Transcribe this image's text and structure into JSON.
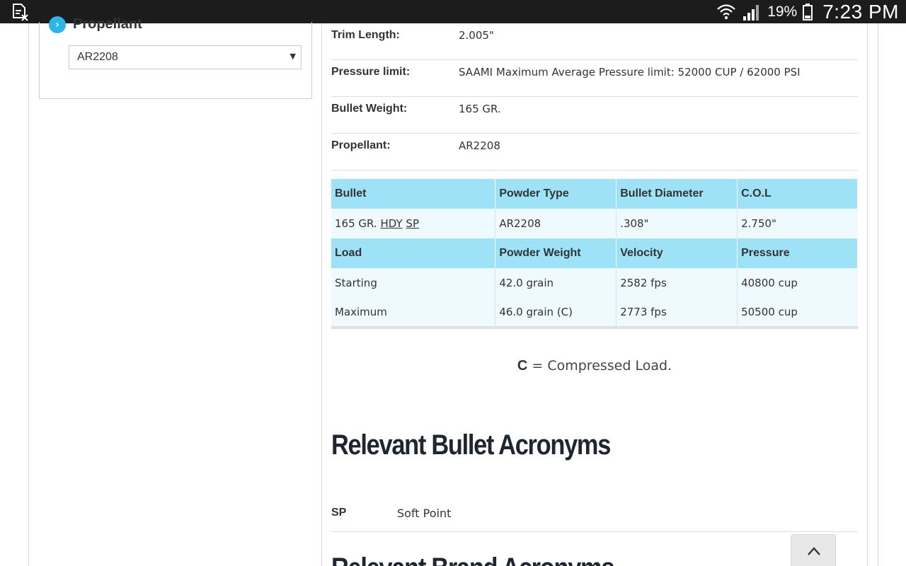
{
  "status_bar": {
    "battery_percent": "19%",
    "time": "7:23 PM",
    "icons": [
      "notification-doc-icon",
      "wifi-icon",
      "signal-icon",
      "battery-icon"
    ]
  },
  "sidebar": {
    "filter_title": "Propellant",
    "propellant_select": {
      "selected": "AR2208"
    }
  },
  "specs": [
    {
      "label": "Trim Length:",
      "value": "2.005\""
    },
    {
      "label": "Pressure limit:",
      "value": "SAAMI Maximum Average Pressure limit: 52000 CUP / 62000 PSI"
    },
    {
      "label": "Bullet Weight:",
      "value": "165 GR."
    },
    {
      "label": "Propellant:",
      "value": "AR2208"
    }
  ],
  "load_table": {
    "header1": [
      "Bullet",
      "Powder Type",
      "Bullet Diameter",
      "C.O.L"
    ],
    "bullet_row": {
      "bullet_prefix": "165 GR.",
      "bullet_brand": "HDY",
      "bullet_type": "SP",
      "powder_type": "AR2208",
      "diameter": ".308\"",
      "col": "2.750\""
    },
    "header2": [
      "Load",
      "Powder Weight",
      "Velocity",
      "Pressure"
    ],
    "loads": [
      {
        "load": "Starting",
        "powder_weight": "42.0 grain",
        "velocity": "2582 fps",
        "pressure": "40800 cup"
      },
      {
        "load": "Maximum",
        "powder_weight": "46.0 grain (C)",
        "velocity": "2773 fps",
        "pressure": "50500 cup"
      }
    ]
  },
  "note": {
    "key": "C",
    "text": " = Compressed Load."
  },
  "bullet_acronyms": {
    "title": "Relevant Bullet Acronyms",
    "items": [
      {
        "key": "SP",
        "value": "Soft Point"
      }
    ]
  },
  "brand_acronyms": {
    "title": "Relevant Brand Acronyms"
  },
  "colors": {
    "table_header": "#9de2f7",
    "table_body": "#eefafe",
    "accent": "#29b6e8"
  }
}
